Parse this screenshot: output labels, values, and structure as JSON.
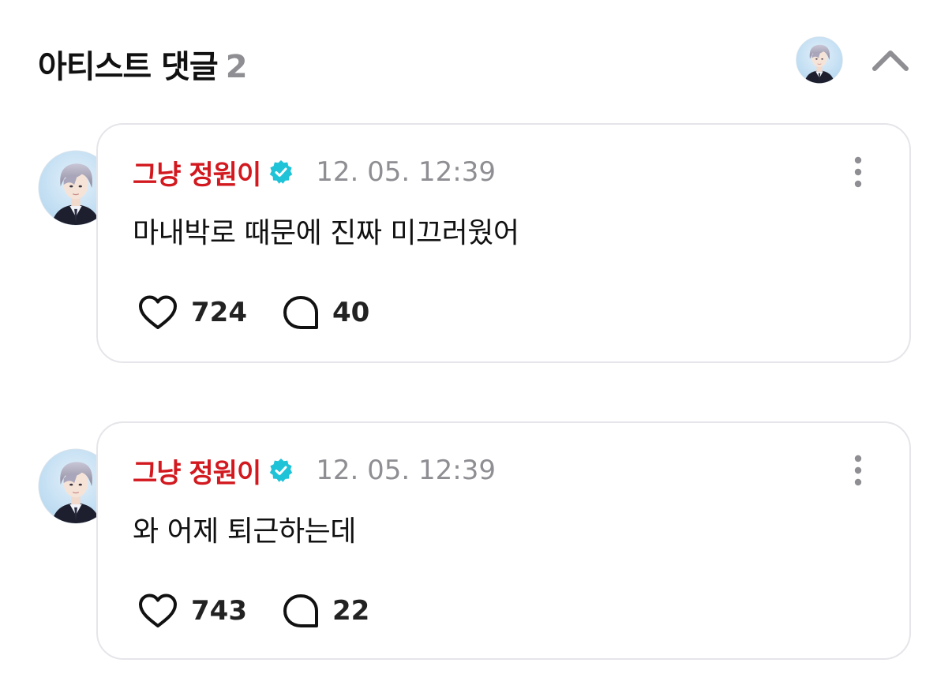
{
  "header": {
    "title": "아티스트 댓글",
    "count": "2",
    "avatar_icon": "artist-avatar",
    "collapse_icon": "chevron-up-icon"
  },
  "colors": {
    "author_name": "#d2191f",
    "verified_badge": "#1ec3d8",
    "timestamp": "#8e8e93",
    "card_border": "#e5e5ea"
  },
  "comments": [
    {
      "author": "그냥 정원이",
      "verified": true,
      "timestamp": "12. 05. 12:39",
      "text": "마내박로 때문에 진짜 미끄러웠어",
      "likes": "724",
      "replies": "40",
      "more_icon": "more-vertical-icon"
    },
    {
      "author": "그냥 정원이",
      "verified": true,
      "timestamp": "12. 05. 12:39",
      "text": "와 어제 퇴근하는데",
      "likes": "743",
      "replies": "22",
      "more_icon": "more-vertical-icon"
    }
  ]
}
